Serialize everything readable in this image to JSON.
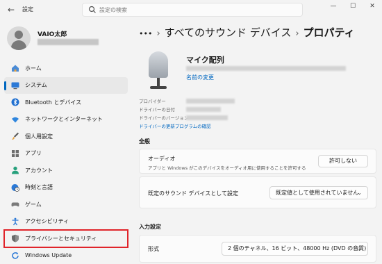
{
  "titlebar": {
    "app_title": "設定",
    "search_placeholder": "設定の検索",
    "minimize": "—",
    "maximize": "☐",
    "close": "✕"
  },
  "profile": {
    "name": "VAIO太郎"
  },
  "sidebar": {
    "items": [
      {
        "label": "ホーム",
        "icon": "home-icon"
      },
      {
        "label": "システム",
        "icon": "system-icon"
      },
      {
        "label": "Bluetooth とデバイス",
        "icon": "bluetooth-icon"
      },
      {
        "label": "ネットワークとインターネット",
        "icon": "wifi-icon"
      },
      {
        "label": "個人用設定",
        "icon": "brush-icon"
      },
      {
        "label": "アプリ",
        "icon": "apps-icon"
      },
      {
        "label": "アカウント",
        "icon": "account-icon"
      },
      {
        "label": "時刻と言語",
        "icon": "globe-clock-icon"
      },
      {
        "label": "ゲーム",
        "icon": "gamepad-icon"
      },
      {
        "label": "アクセシビリティ",
        "icon": "accessibility-icon"
      },
      {
        "label": "プライバシーとセキュリティ",
        "icon": "shield-icon"
      },
      {
        "label": "Windows Update",
        "icon": "update-icon"
      }
    ],
    "active_index": 1,
    "highlight_color": "#e0242a"
  },
  "breadcrumb": {
    "ellipsis": "•••",
    "parent": "すべてのサウンド デバイス",
    "current": "プロパティ"
  },
  "device": {
    "name": "マイク配列",
    "rename_link": "名前の変更",
    "provider_label": "プロバイダー",
    "driver_date_label": "ドライバーの日付",
    "driver_version_label": "ドライバーのバージョン",
    "driver_update_link": "ドライバーの更新プログラムの確認"
  },
  "general": {
    "title": "全般",
    "audio_title": "オーディオ",
    "audio_desc": "アプリと Windows がこのデバイスをオーディオ用に使用することを許可する",
    "audio_button": "許可しない",
    "default_label": "既定のサウンド デバイスとして設定",
    "default_value": "既定値として使用されていません"
  },
  "input_settings": {
    "title": "入力設定",
    "format_label": "形式",
    "format_value": "2 個のチャネル、16 ビット、48000 Hz (DVD の音質)"
  },
  "colors": {
    "accent": "#0067c0",
    "background": "#f3f3f3",
    "card": "#fbfbfb"
  }
}
